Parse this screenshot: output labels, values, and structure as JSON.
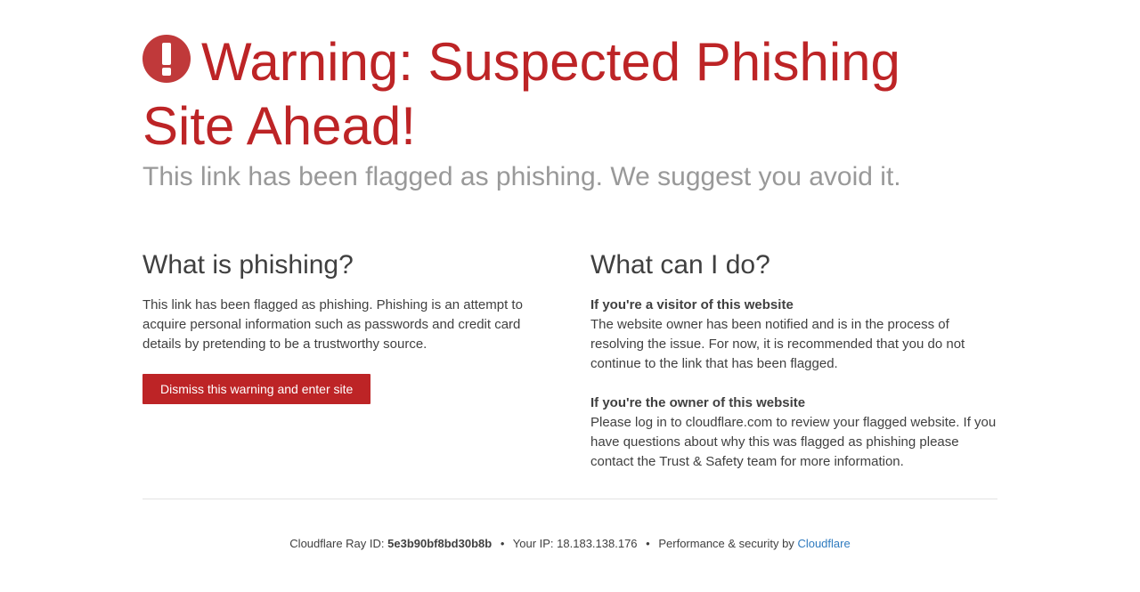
{
  "header": {
    "title": "Warning: Suspected Phishing Site Ahead!",
    "subtitle": "This link has been flagged as phishing. We suggest you avoid it."
  },
  "left": {
    "heading": "What is phishing?",
    "body": "This link has been flagged as phishing. Phishing is an attempt to acquire personal information such as passwords and credit card details by pretending to be a trustworthy source.",
    "button_label": "Dismiss this warning and enter site"
  },
  "right": {
    "heading": "What can I do?",
    "visitor_heading": "If you're a visitor of this website",
    "visitor_body": "The website owner has been notified and is in the process of resolving the issue. For now, it is recommended that you do not continue to the link that has been flagged.",
    "owner_heading": "If you're the owner of this website",
    "owner_body": "Please log in to cloudflare.com to review your flagged website. If you have questions about why this was flagged as phishing please contact the Trust & Safety team for more information."
  },
  "footer": {
    "ray_label": "Cloudflare Ray ID:",
    "ray_id": "5e3b90bf8bd30b8b",
    "bullet": "•",
    "ip_label": "Your IP:",
    "ip": "18.183.138.176",
    "perf_label": "Performance & security by",
    "cloudflare_link": "Cloudflare"
  },
  "icons": {
    "warning": "exclamation-circle-icon"
  },
  "colors": {
    "accent": "#bd2426",
    "link": "#2f7bbf",
    "muted": "#999999",
    "text": "#404040"
  }
}
